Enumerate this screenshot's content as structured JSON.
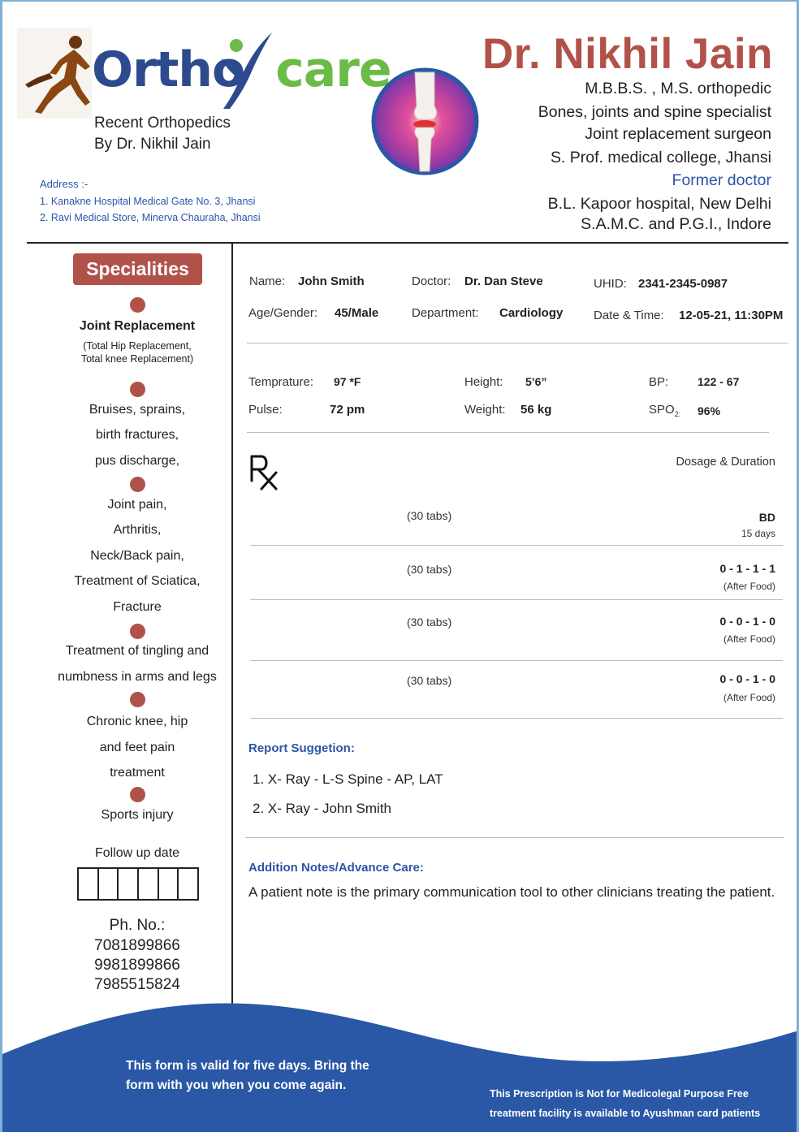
{
  "brand": {
    "logo_ortho": "Ortho",
    "logo_care": "care",
    "tagline_line1": "Recent Orthopedics",
    "tagline_line2": "By Dr. Nikhil Jain",
    "address_label": "Address :-",
    "address_lines": [
      "1. Kanakne Hospital Medical Gate No. 3, Jhansi",
      "2. Ravi Medical Store, Minerva Chauraha, Jhansi"
    ]
  },
  "doctor": {
    "name": "Dr. Nikhil Jain",
    "credentials": [
      "M.B.B.S. , M.S. orthopedic",
      "Bones, joints and spine specialist",
      "Joint replacement surgeon",
      "S. Prof. medical college, Jhansi"
    ],
    "former_label": "Former doctor",
    "former": [
      "B.L. Kapoor hospital, New Delhi",
      "S.A.M.C. and P.G.I., Indore"
    ]
  },
  "sidebar": {
    "title": "Specialities",
    "joint_title": "Joint Replacement",
    "joint_sub1": "(Total Hip Replacement,",
    "joint_sub2": "Total knee Replacement)",
    "group2": [
      "Bruises, sprains,",
      "birth fractures,",
      "pus discharge,"
    ],
    "group3": [
      "Joint pain,",
      "Arthritis,",
      "Neck/Back pain,",
      "Treatment of Sciatica,",
      "Fracture"
    ],
    "group4": [
      "Treatment of tingling and",
      "numbness in arms and legs"
    ],
    "group5": [
      "Chronic knee, hip",
      "and feet pain",
      "treatment"
    ],
    "group6": [
      "Sports injury"
    ],
    "follow_up_label": "Follow up date",
    "phone_label": "Ph. No.:",
    "phones": [
      "7081899866",
      "9981899866",
      "7985515824"
    ]
  },
  "patient": {
    "name_label": "Name:",
    "name": "John Smith",
    "doctor_label": "Doctor:",
    "doctor": "Dr. Dan Steve",
    "uhid_label": "UHID:",
    "uhid": "2341-2345-0987",
    "age_label": "Age/Gender:",
    "age": "45/Male",
    "dept_label": "Department:",
    "dept": "Cardiology",
    "date_label": "Date & Time:",
    "date": "12-05-21, 11:30PM"
  },
  "vitals": {
    "temp_label": "Temprature:",
    "temp": "97 *F",
    "height_label": "Height:",
    "height": "5’6”",
    "bp_label": "BP:",
    "bp": "122 - 67",
    "pulse_label": "Pulse:",
    "pulse": "72 pm",
    "weight_label": "Weight:",
    "weight": "56 kg",
    "spo2_label": "SPO",
    "spo2_sub": "2:",
    "spo2": "96%"
  },
  "prescription": {
    "dosage_header": "Dosage & Duration",
    "items": [
      {
        "qty": "(30 tabs)",
        "dose": "BD",
        "note": "15 days"
      },
      {
        "qty": "(30 tabs)",
        "dose": "0 - 1 - 1 - 1",
        "note": "(After Food)"
      },
      {
        "qty": "(30 tabs)",
        "dose": "0 - 0 - 1 - 0",
        "note": "(After Food)"
      },
      {
        "qty": "(30 tabs)",
        "dose": "0 - 0 - 1 - 0",
        "note": "(After Food)"
      }
    ]
  },
  "report": {
    "title": "Report Suggetion:",
    "items": [
      "1. X- Ray - L-S Spine - AP, LAT",
      "2. X- Ray - John Smith"
    ]
  },
  "notes": {
    "title": "Addition Notes/Advance Care:",
    "text": "A patient note is the primary communication tool to other clinicians treating the patient."
  },
  "footer": {
    "left_line1": "This form is valid for five days. Bring the",
    "left_line2": "form with you when you come again.",
    "right_line1": "This Prescription is Not for Medicolegal Purpose Free",
    "right_line2": "treatment facility is available to Ayushman card patients"
  },
  "colors": {
    "accent_red": "#b0524a",
    "brand_blue": "#2e4a8e",
    "brand_green": "#6cbb47",
    "link_blue": "#2c55a8",
    "footer_blue": "#2a57a6"
  }
}
